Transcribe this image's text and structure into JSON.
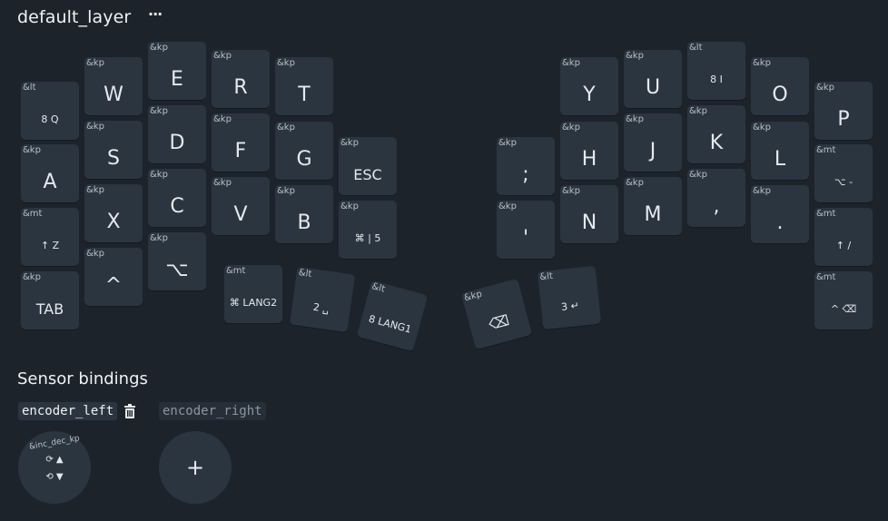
{
  "layer": {
    "name": "default_layer",
    "menu_label": "···"
  },
  "keys": [
    {
      "b": "&lt",
      "l": "8 Q",
      "s": "small"
    },
    {
      "b": "&kp",
      "l": "W"
    },
    {
      "b": "&kp",
      "l": "E"
    },
    {
      "b": "&kp",
      "l": "R"
    },
    {
      "b": "&kp",
      "l": "T"
    },
    {
      "b": "&kp",
      "l": "A"
    },
    {
      "b": "&kp",
      "l": "S"
    },
    {
      "b": "&kp",
      "l": "D"
    },
    {
      "b": "&kp",
      "l": "F"
    },
    {
      "b": "&kp",
      "l": "G"
    },
    {
      "b": "&kp",
      "l": "ESC",
      "s": "mid"
    },
    {
      "b": "&mt",
      "l": "↑ Z",
      "s": "small"
    },
    {
      "b": "&kp",
      "l": "X"
    },
    {
      "b": "&kp",
      "l": "C"
    },
    {
      "b": "&kp",
      "l": "V"
    },
    {
      "b": "&kp",
      "l": "B"
    },
    {
      "b": "&kp",
      "l": "⌘ | 5",
      "s": "small"
    },
    {
      "b": "&kp",
      "l": "TAB",
      "s": "mid"
    },
    {
      "b": "&kp",
      "l": "^"
    },
    {
      "b": "&kp",
      "l": "⌥"
    },
    {
      "b": "&mt",
      "l": "⌘ LANG2",
      "s": "small"
    },
    {
      "b": "&lt",
      "l": "2 ␣",
      "s": "small"
    },
    {
      "b": "&lt",
      "l": "8 LANG1",
      "s": "small"
    },
    {
      "b": "&kp",
      "l": "⌫",
      "s": "mid"
    },
    {
      "b": "&lt",
      "l": "3 ↵",
      "s": "small"
    },
    {
      "b": "&kp",
      "l": "Y"
    },
    {
      "b": "&kp",
      "l": "U"
    },
    {
      "b": "&lt",
      "l": "8 I",
      "s": "small"
    },
    {
      "b": "&kp",
      "l": "O"
    },
    {
      "b": "&kp",
      "l": "P"
    },
    {
      "b": "&kp",
      "l": ";"
    },
    {
      "b": "&kp",
      "l": "H"
    },
    {
      "b": "&kp",
      "l": "J"
    },
    {
      "b": "&kp",
      "l": "K"
    },
    {
      "b": "&kp",
      "l": "L"
    },
    {
      "b": "&mt",
      "l": "⌥ -",
      "s": "small"
    },
    {
      "b": "&kp",
      "l": "'"
    },
    {
      "b": "&kp",
      "l": "N"
    },
    {
      "b": "&kp",
      "l": "M"
    },
    {
      "b": "&kp",
      "l": ","
    },
    {
      "b": "&kp",
      "l": "."
    },
    {
      "b": "&mt",
      "l": "↑ /",
      "s": "small"
    },
    {
      "b": "&mt",
      "l": "^ ⌫",
      "s": "small"
    }
  ],
  "sensors": {
    "title": "Sensor bindings",
    "tabs": [
      "encoder_left",
      "encoder_right"
    ],
    "binding": {
      "label": "&inc_dec_kp",
      "cw": "⟳ ▲",
      "ccw": "⟲ ▼"
    },
    "add_label": "+"
  }
}
